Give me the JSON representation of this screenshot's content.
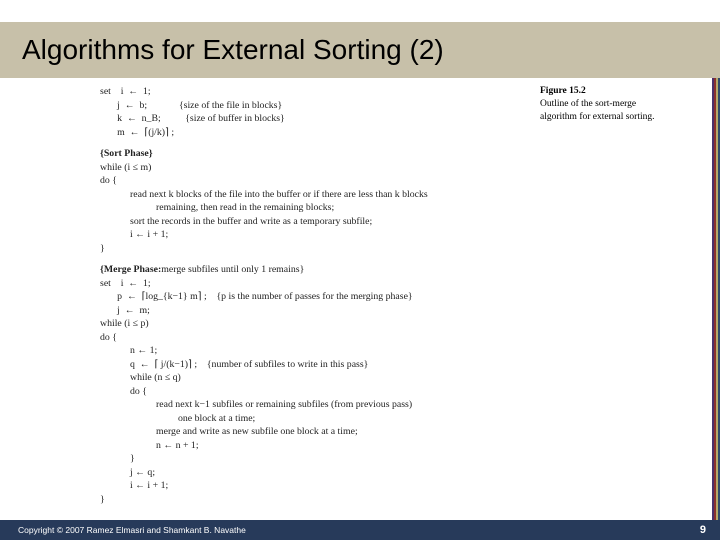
{
  "slide": {
    "title": "Algorithms for External Sorting (2)",
    "copyright": "Copyright © 2007 Ramez Elmasri and Shamkant B. Navathe",
    "page_number": "9"
  },
  "figure": {
    "label": "Figure 15.2",
    "caption": "Outline of the sort-merge algorithm for external sorting."
  },
  "algo": {
    "set_kw": "set",
    "init": [
      {
        "code": "i  ←  1;",
        "comment": ""
      },
      {
        "code": "j  ←  b;",
        "comment": "{size of the file in blocks}"
      },
      {
        "code": "k  ←  n_B;",
        "comment": "{size of buffer in blocks}"
      },
      {
        "code": "m  ←  ⌈(j/k)⌉ ;",
        "comment": ""
      }
    ],
    "sort_phase_label": "{Sort Phase}",
    "sort": {
      "while": "while (i ≤ m)",
      "do": "do {",
      "body1": "read next k blocks of the file into the buffer or if there are less than k blocks",
      "body1b": "remaining, then read in the remaining blocks;",
      "body2": "sort the records in the buffer and write as a temporary subfile;",
      "body3": "i  ←  i + 1;",
      "close": "}"
    },
    "merge_phase_label": "{Merge Phase:",
    "merge_phase_desc": "merge subfiles until only 1 remains}",
    "merge_init": [
      {
        "code": "i  ←  1;",
        "comment": ""
      },
      {
        "code": "p  ←  ⌈log_{k−1} m⌉ ;",
        "comment": "{p is the number of passes for the merging phase}"
      },
      {
        "code": "j  ←  m;",
        "comment": ""
      }
    ],
    "merge_outer": {
      "while": "while (i ≤ p)",
      "do": "do {",
      "line_n": "n  ←  1;",
      "line_q": "q  ←  ⌈ j/(k−1)⌉ ;",
      "line_q_comment": "{number of subfiles to write in this pass}",
      "while_inner": "while (n ≤ q)",
      "do_inner": "do {",
      "body1": "read next k−1 subfiles or remaining subfiles (from previous pass)",
      "body1b": "one block at a time;",
      "body2": "merge and write as new subfile one block at a time;",
      "body3": "n  ←  n + 1;",
      "close_inner": "}",
      "line_j": "j  ←  q;",
      "line_i": "i  ←  i + 1;",
      "close": "}"
    }
  }
}
